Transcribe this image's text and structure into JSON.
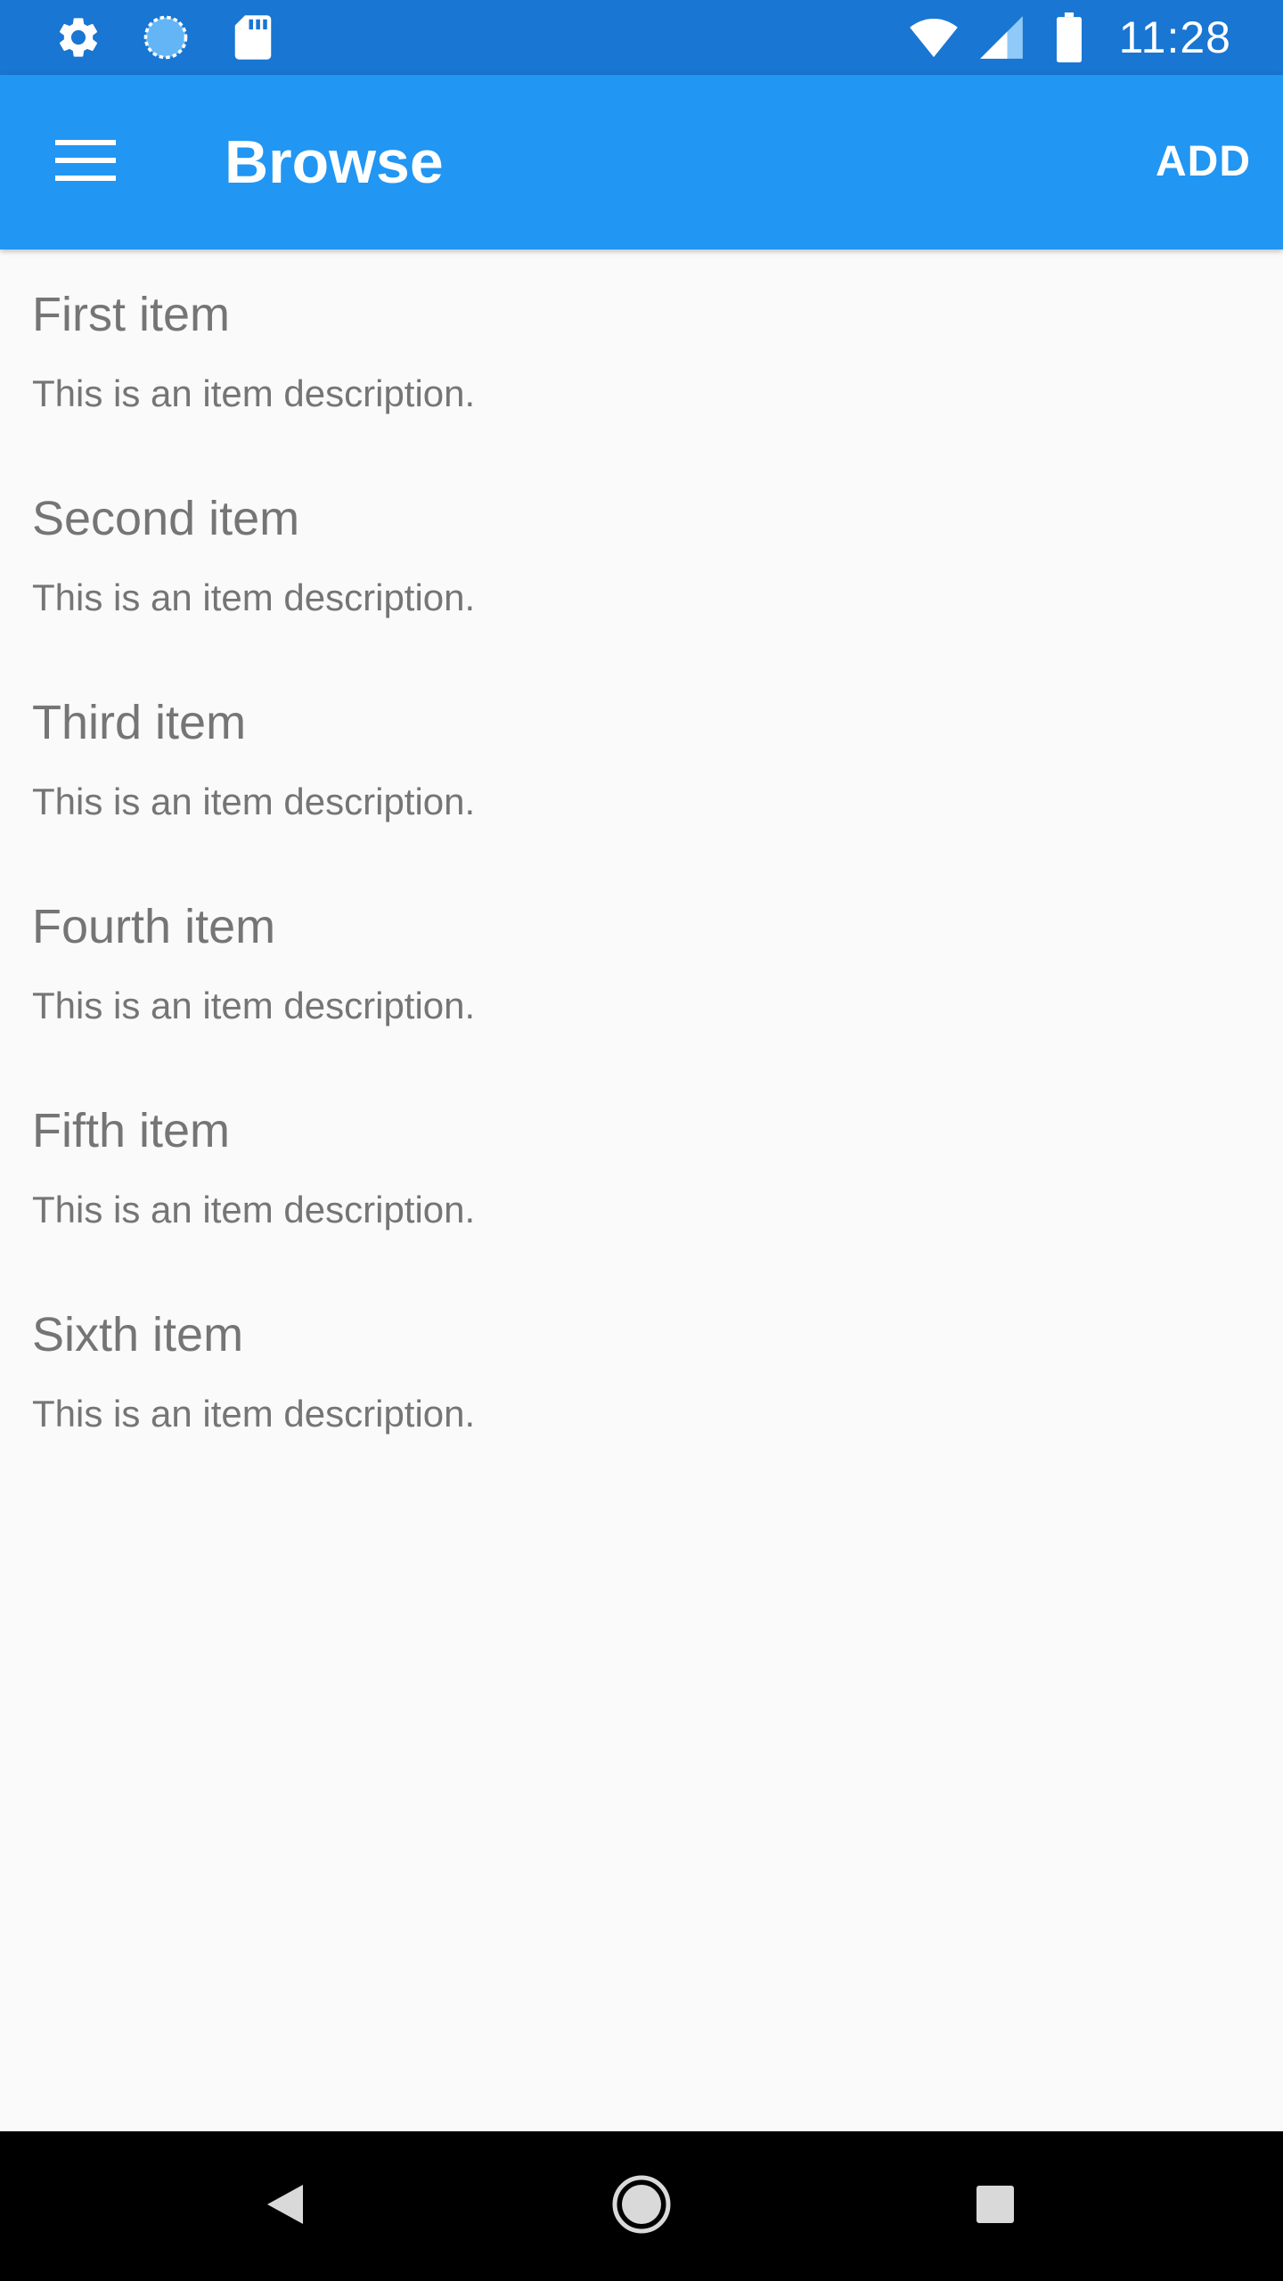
{
  "status_bar": {
    "time": "11:28",
    "icons": [
      "settings-icon",
      "sync-icon",
      "sd-card-icon",
      "wifi-icon",
      "cell-signal-icon",
      "battery-icon"
    ]
  },
  "app_bar": {
    "title": "Browse",
    "add_label": "ADD",
    "color": "#2196f3",
    "status_color": "#1976d2"
  },
  "items": [
    {
      "title": "First item",
      "description": "This is an item description."
    },
    {
      "title": "Second item",
      "description": "This is an item description."
    },
    {
      "title": "Third item",
      "description": "This is an item description."
    },
    {
      "title": "Fourth item",
      "description": "This is an item description."
    },
    {
      "title": "Fifth item",
      "description": "This is an item description."
    },
    {
      "title": "Sixth item",
      "description": "This is an item description."
    }
  ],
  "nav_bar": {
    "icons": [
      "back-icon",
      "home-icon",
      "recents-icon"
    ]
  }
}
